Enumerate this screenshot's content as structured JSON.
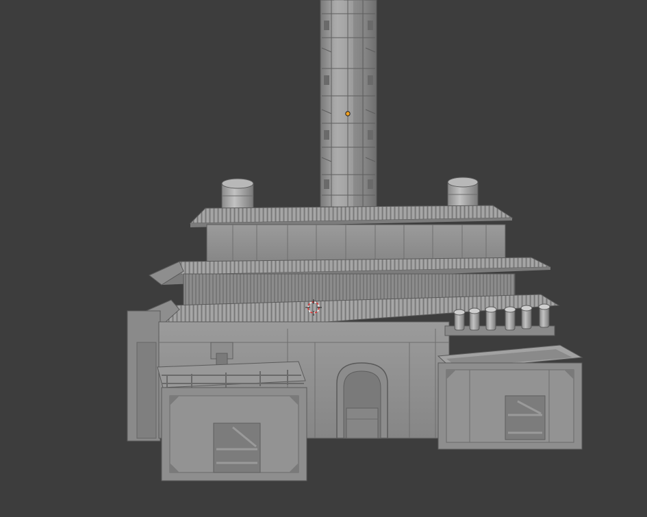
{
  "viewport": {
    "background": "#3d3d3d",
    "mode": "solid-shading",
    "object": "industrial-factory-model",
    "colors": {
      "model_base": "#8e8e8e",
      "model_light": "#a9a9a9",
      "model_dark": "#6a6a6a",
      "roof_tile": "#9a9a9a",
      "edge": "#5a5a5a",
      "origin": "#f0a020",
      "cursor_red": "#e03030"
    }
  },
  "icons": {
    "object_origin": "origin-dot-icon",
    "cursor_3d": "3d-cursor-icon"
  }
}
